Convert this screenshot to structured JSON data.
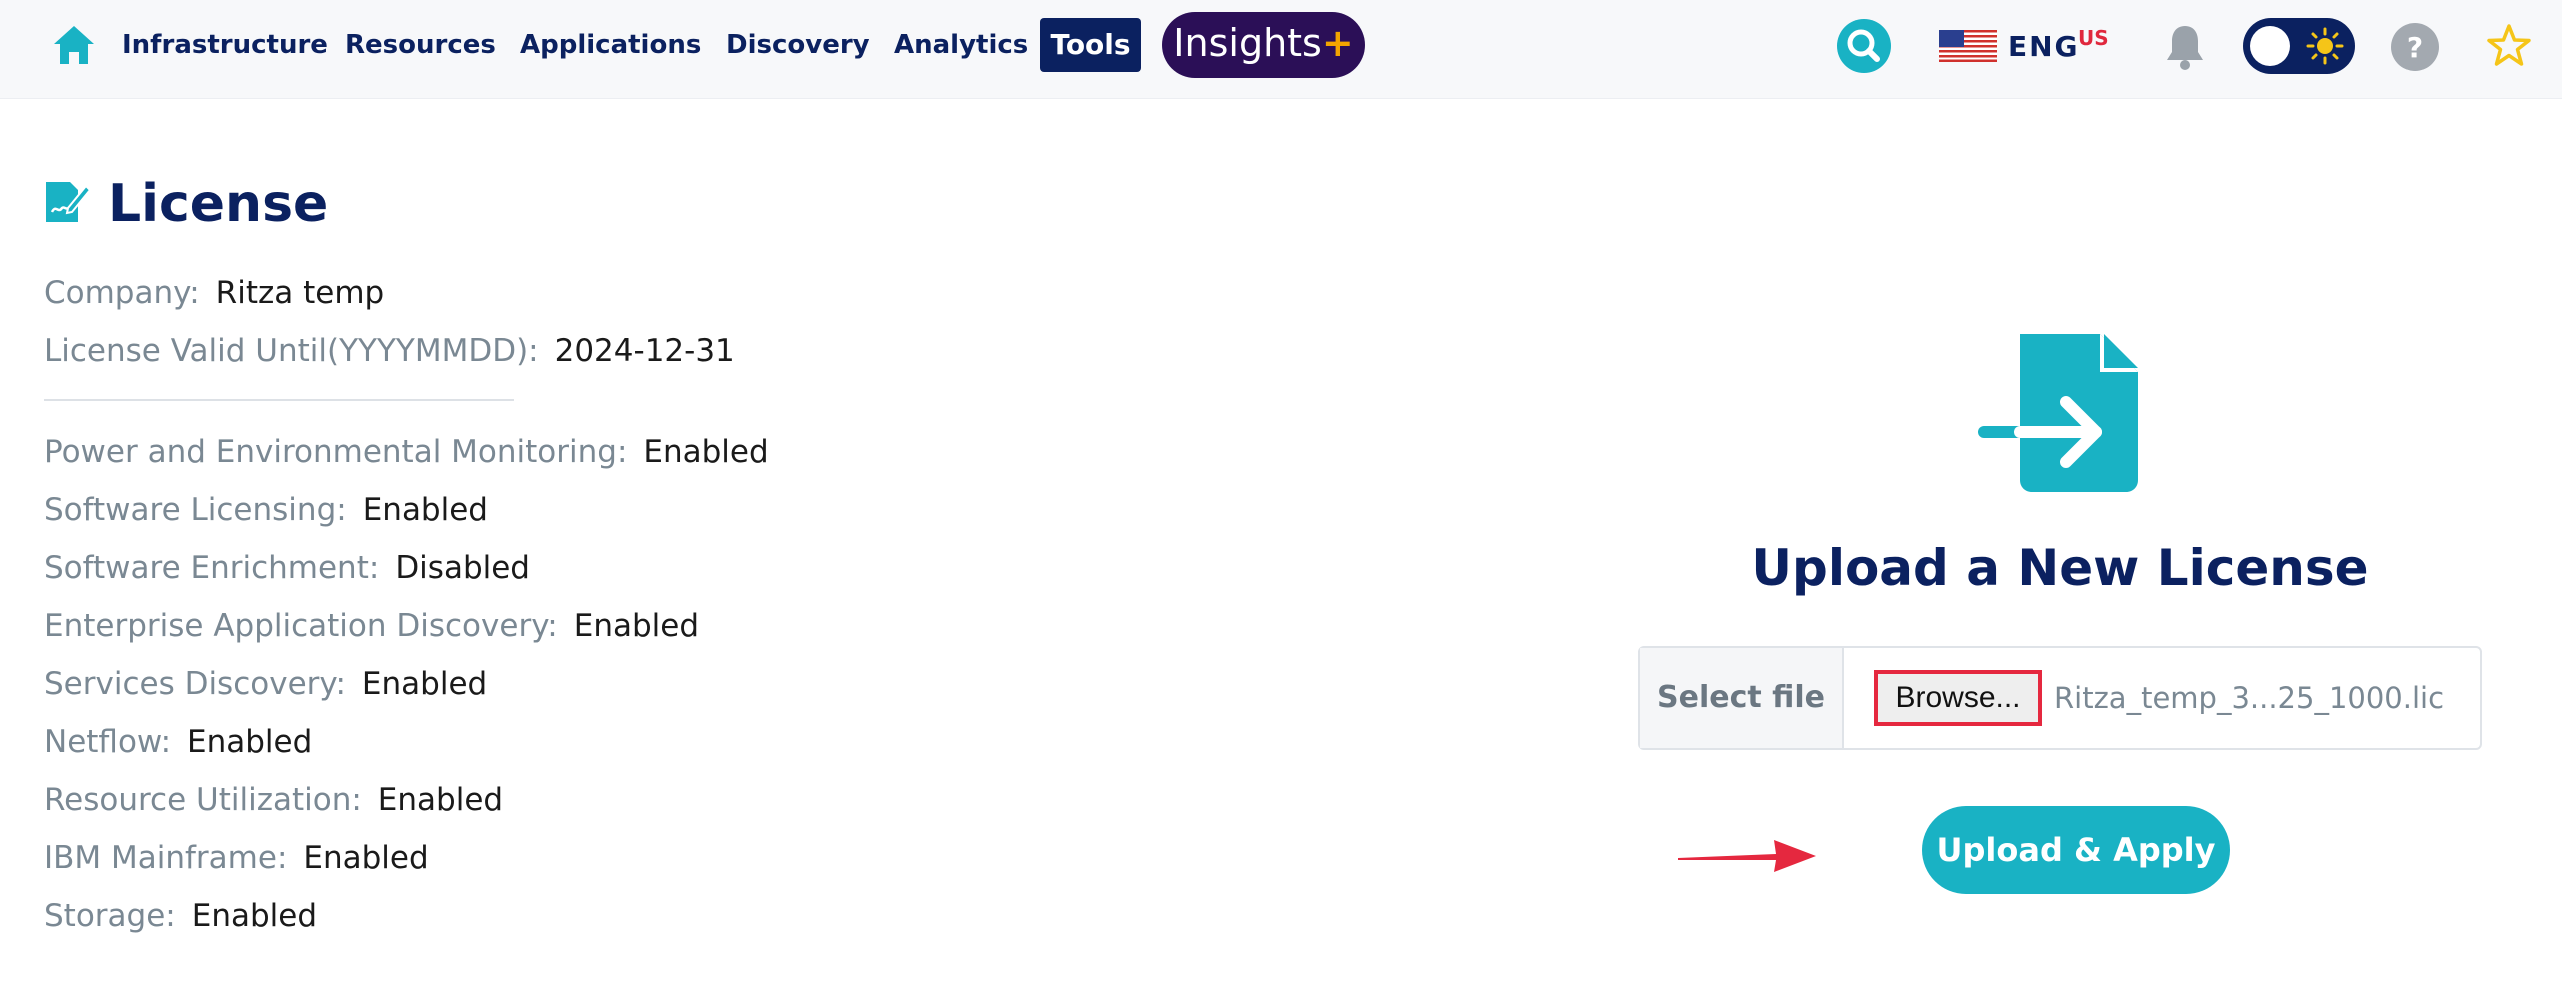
{
  "nav": {
    "items": [
      "Infrastructure",
      "Resources",
      "Applications",
      "Discovery",
      "Analytics",
      "Tools"
    ],
    "insights_label": "Insights",
    "insights_plus": "+",
    "lang_label": "ENG",
    "lang_region": "US"
  },
  "colors": {
    "brand_navy": "#0b2160",
    "accent_teal": "#19b2c4",
    "insights_purple": "#2b0f57",
    "annotation_red": "#e5283f"
  },
  "page": {
    "title": "License"
  },
  "license": {
    "company_label": "Company:",
    "company_value": "Ritza temp",
    "valid_label": "License Valid Until(YYYYMMDD):",
    "valid_value": "2024-12-31",
    "features": [
      {
        "label": "Power and Environmental Monitoring:",
        "value": "Enabled"
      },
      {
        "label": "Software Licensing:",
        "value": "Enabled"
      },
      {
        "label": "Software Enrichment:",
        "value": "Disabled"
      },
      {
        "label": "Enterprise Application Discovery:",
        "value": "Enabled"
      },
      {
        "label": "Services Discovery:",
        "value": "Enabled"
      },
      {
        "label": "Netflow:",
        "value": "Enabled"
      },
      {
        "label": "Resource Utilization:",
        "value": "Enabled"
      },
      {
        "label": "IBM Mainframe:",
        "value": "Enabled"
      },
      {
        "label": "Storage:",
        "value": "Enabled"
      }
    ]
  },
  "upload": {
    "title": "Upload a New License",
    "select_label": "Select file",
    "browse_label": "Browse...",
    "file_name": "Ritza_temp_3...25_1000.lic",
    "apply_label": "Upload & Apply"
  }
}
